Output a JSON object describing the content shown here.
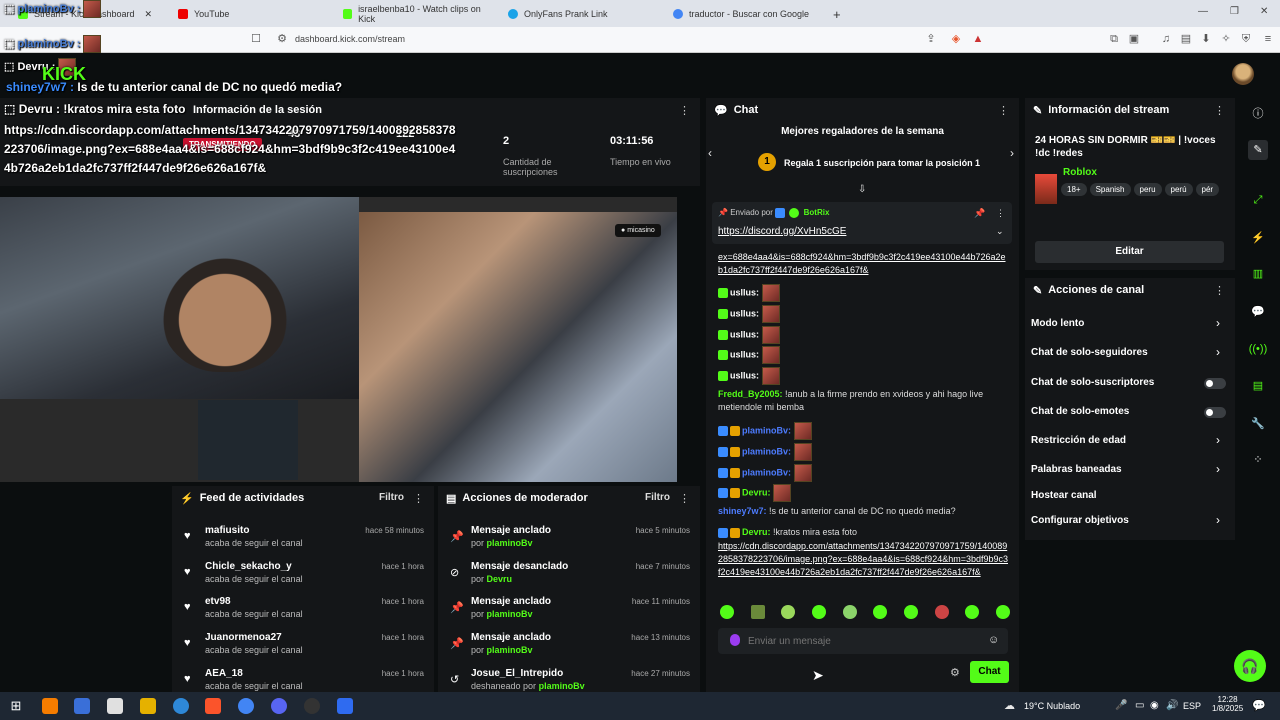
{
  "browser": {
    "tabs": [
      {
        "label": "Stream - Kick Dashboard"
      },
      {
        "label": "YouTube"
      },
      {
        "label": "israelbenba10 - Watch clips on Kick"
      },
      {
        "label": "OnlyFans Prank Link"
      },
      {
        "label": "traductor - Buscar con Google"
      }
    ],
    "new_tab": "+",
    "url": "dashboard.kick.com/stream"
  },
  "overlay": {
    "lines": [
      {
        "user": "plaminoBv :",
        "msg": ""
      },
      {
        "user": "plaminoBv :",
        "msg": ""
      },
      {
        "user": "Devru :",
        "msg": ""
      },
      {
        "user": "shiney7w7 :",
        "msg": "Is de tu anterior canal de DC no quedó media?"
      },
      {
        "user": "Devru :",
        "msg": "!kratos mira esta foto"
      }
    ],
    "link": "https://cdn.discordapp.com/attachments/1347342207970971759/1400892858378223706/image.png?ex=688e4aa4&is=688cf924&hm=3bdf9b9c3f2c419ee43100e44b726a2eb1da2fc737ff2f447de9f26e626a167f&",
    "logo": "KICK"
  },
  "session": {
    "title": "Información de la sesión",
    "status": "TRANSMITIENDO",
    "stats": [
      {
        "value": "43",
        "label": ""
      },
      {
        "value": "122",
        "label": ""
      },
      {
        "value": "2",
        "label": "Cantidad de suscripciones"
      },
      {
        "value": "03:11:56",
        "label": "Tiempo en vivo"
      }
    ]
  },
  "video": {
    "overlay_brand": "micasino"
  },
  "activity_feed": {
    "title": "Feed de actividades",
    "filter": "Filtro",
    "items": [
      {
        "name": "mafiusito",
        "sub": "acaba de seguir el canal",
        "time": "hace 58 minutos"
      },
      {
        "name": "Chicle_sekacho_y",
        "sub": "acaba de seguir el canal",
        "time": "hace 1 hora"
      },
      {
        "name": "etv98",
        "sub": "acaba de seguir el canal",
        "time": "hace 1 hora"
      },
      {
        "name": "Juanormenoa27",
        "sub": "acaba de seguir el canal",
        "time": "hace 1 hora"
      },
      {
        "name": "AEA_18",
        "sub": "acaba de seguir el canal",
        "time": "hace 1 hora"
      }
    ]
  },
  "mod_actions": {
    "title": "Acciones de moderador",
    "filter": "Filtro",
    "items": [
      {
        "name": "Mensaje anclado",
        "prefix": "por",
        "by": "plaminoBv",
        "time": "hace 5 minutos"
      },
      {
        "name": "Mensaje desanclado",
        "prefix": "por",
        "by": "Devru",
        "time": "hace 7 minutos"
      },
      {
        "name": "Mensaje anclado",
        "prefix": "por",
        "by": "plaminoBv",
        "time": "hace 11 minutos"
      },
      {
        "name": "Mensaje anclado",
        "prefix": "por",
        "by": "plaminoBv",
        "time": "hace 13 minutos"
      },
      {
        "name": "Josue_El_Intrepido",
        "prefix": "deshaneado por",
        "by": "plaminoBv",
        "time": "hace 27 minutos"
      }
    ]
  },
  "chat": {
    "title": "Chat",
    "top_gifters": "Mejores regaladores de la semana",
    "gift_cta": "Regala 1 suscripción para tomar la posición 1",
    "rank": "1",
    "pinned": {
      "by_label": "Enviado por",
      "user": "BotRix",
      "link": "https://discord.gg/XvHn5cGE"
    },
    "link_tail": "ex=688e4aa4&is=688cf924&hm=3bdf9b9c3f2c419ee43100e44b726a2eb1da2fc737ff2f447de9f26e626a167f&",
    "emote_rows": [
      {
        "user": "usllus:"
      },
      {
        "user": "usllus:"
      },
      {
        "user": "usllus:"
      },
      {
        "user": "usllus:"
      },
      {
        "user": "usllus:"
      }
    ],
    "fredd": {
      "user": "Fredd_By2005:",
      "msg": "!anub a la firme prendo en xvideos y ahi hago live metiendole mi bemba"
    },
    "plamino_rows": [
      {
        "user": "plaminoBv:"
      },
      {
        "user": "plaminoBv:"
      },
      {
        "user": "plaminoBv:"
      }
    ],
    "devru_emote": {
      "user": "Devru:"
    },
    "shiney": {
      "user": "shiney7w7:",
      "msg": "!s de tu anterior canal de DC no quedó media?"
    },
    "devru_msg": {
      "user": "Devru:",
      "msg": "!kratos mira esta foto"
    },
    "devru_link": "https://cdn.discordapp.com/attachments/1347342207970971759/1400892858378223706/image.png?ex=688e4aa4&is=688cf924&hm=3bdf9b9c3f2c419ee43100e44b726a2eb1da2fc737ff2f447de9f26e626a167f&",
    "input_placeholder": "Enviar un mensaje",
    "send_label": "Chat"
  },
  "stream_info": {
    "title": "Información del stream",
    "stream_title": "24 HORAS SIN DORMIR 🎫🎫 | !voces !dc !redes",
    "category": "Roblox",
    "tags": [
      "18+",
      "Spanish",
      "peru",
      "perú",
      "pér"
    ],
    "edit_label": "Editar"
  },
  "channel_actions": {
    "title": "Acciones de canal",
    "items": [
      {
        "label": "Modo lento",
        "kind": "chevron"
      },
      {
        "label": "Chat de solo-seguidores",
        "kind": "chevron"
      },
      {
        "label": "Chat de solo-suscriptores",
        "kind": "toggle"
      },
      {
        "label": "Chat de solo-emotes",
        "kind": "toggle"
      },
      {
        "label": "Restricción de edad",
        "kind": "chevron"
      },
      {
        "label": "Palabras baneadas",
        "kind": "chevron"
      },
      {
        "label": "Hostear canal",
        "kind": "none"
      },
      {
        "label": "Configurar objetivos",
        "kind": "chevron"
      }
    ]
  },
  "taskbar": {
    "weather": "19°C Nublado",
    "lang": "ESP",
    "time": "12:28",
    "date": "1/8/2025"
  },
  "colors": {
    "kick_green": "#53fc18",
    "live_red": "#c8102e",
    "link_blue": "#4d7cff"
  }
}
